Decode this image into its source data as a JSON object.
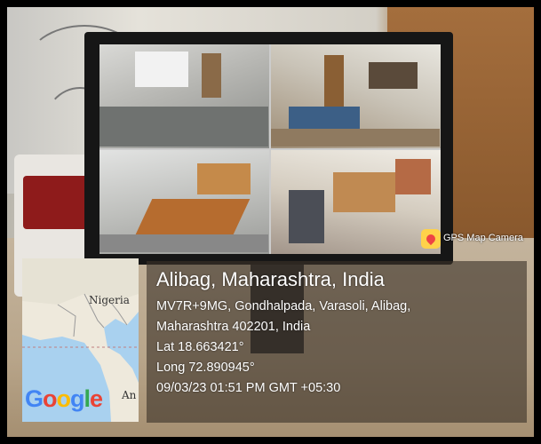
{
  "stamp": {
    "app_name": "GPS Map Camera",
    "city": "Alibag, Maharashtra, India",
    "address_line1": "MV7R+9MG, Gondhalpada, Varasoli, Alibag,",
    "address_line2": "Maharashtra 402201, India",
    "lat": "Lat 18.663421°",
    "long": "Long 72.890945°",
    "datetime": "09/03/23 01:51 PM GMT +05:30"
  },
  "map": {
    "label_country": "Nigeria",
    "label_partial": "An",
    "google_logo": [
      "G",
      "o",
      "o",
      "g",
      "l",
      "e"
    ]
  },
  "monitor": {
    "feeds": [
      "cctv-feed-1",
      "cctv-feed-2",
      "cctv-feed-3",
      "cctv-feed-4"
    ]
  }
}
